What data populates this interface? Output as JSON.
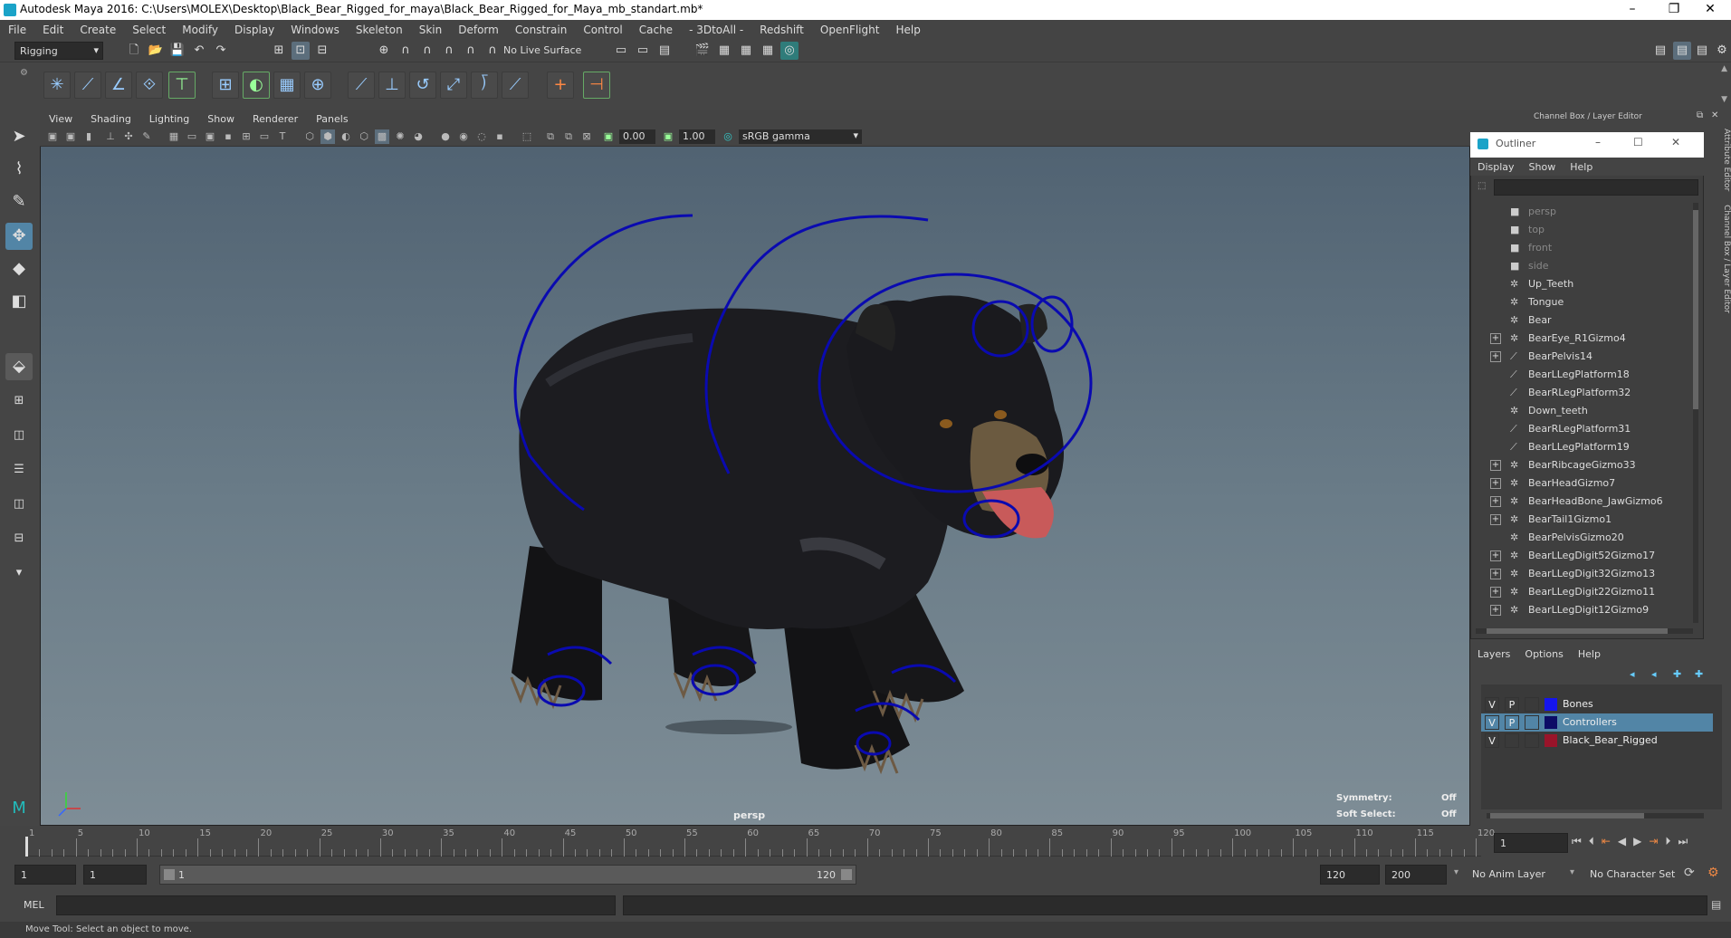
{
  "window": {
    "title": "Autodesk Maya 2016: C:\\Users\\MOLEX\\Desktop\\Black_Bear_Rigged_for_maya\\Black_Bear_Rigged_for_Maya_mb_standart.mb*",
    "minimize": "–",
    "maximize": "❐",
    "close": "✕"
  },
  "menubar": [
    "File",
    "Edit",
    "Create",
    "Select",
    "Modify",
    "Display",
    "Windows",
    "Skeleton",
    "Skin",
    "Deform",
    "Constrain",
    "Control",
    "Cache",
    "- 3DtoAll -",
    "Redshift",
    "OpenFlight",
    "Help"
  ],
  "status": {
    "menuset": "Rigging",
    "live_surface": "No Live Surface"
  },
  "viewport": {
    "menu": [
      "View",
      "Shading",
      "Lighting",
      "Show",
      "Renderer",
      "Panels"
    ],
    "field1": "0.00",
    "field2": "1.00",
    "colorspace": "sRGB gamma",
    "camera": "persp",
    "hud": {
      "symmetry_label": "Symmetry:",
      "symmetry_value": "Off",
      "softselect_label": "Soft Select:",
      "softselect_value": "Off"
    }
  },
  "right_panel": {
    "header": "Channel Box / Layer Editor",
    "side_tabs": [
      "Attribute Editor",
      "Channel Box / Layer Editor"
    ]
  },
  "outliner": {
    "title": "Outliner",
    "menu": [
      "Display",
      "Show",
      "Help"
    ],
    "items": [
      {
        "label": "persp",
        "dim": true,
        "expand": false,
        "icon": "camera-icon"
      },
      {
        "label": "top",
        "dim": true,
        "expand": false,
        "icon": "camera-icon"
      },
      {
        "label": "front",
        "dim": true,
        "expand": false,
        "icon": "camera-icon"
      },
      {
        "label": "side",
        "dim": true,
        "expand": false,
        "icon": "camera-icon"
      },
      {
        "label": "Up_Teeth",
        "dim": false,
        "expand": false,
        "icon": "mesh-icon"
      },
      {
        "label": "Tongue",
        "dim": false,
        "expand": false,
        "icon": "mesh-icon"
      },
      {
        "label": "Bear",
        "dim": false,
        "expand": false,
        "icon": "mesh-icon"
      },
      {
        "label": "BearEye_R1Gizmo4",
        "dim": false,
        "expand": true,
        "icon": "mesh-icon"
      },
      {
        "label": "BearPelvis14",
        "dim": false,
        "expand": true,
        "icon": "joint-icon"
      },
      {
        "label": "BearLLegPlatform18",
        "dim": false,
        "expand": false,
        "icon": "joint-icon"
      },
      {
        "label": "BearRLegPlatform32",
        "dim": false,
        "expand": false,
        "icon": "joint-icon"
      },
      {
        "label": "Down_teeth",
        "dim": false,
        "expand": false,
        "icon": "mesh-icon"
      },
      {
        "label": "BearRLegPlatform31",
        "dim": false,
        "expand": false,
        "icon": "joint-icon"
      },
      {
        "label": "BearLLegPlatform19",
        "dim": false,
        "expand": false,
        "icon": "joint-icon"
      },
      {
        "label": "BearRibcageGizmo33",
        "dim": false,
        "expand": true,
        "icon": "mesh-icon"
      },
      {
        "label": "BearHeadGizmo7",
        "dim": false,
        "expand": true,
        "icon": "mesh-icon"
      },
      {
        "label": "BearHeadBone_JawGizmo6",
        "dim": false,
        "expand": true,
        "icon": "mesh-icon"
      },
      {
        "label": "BearTail1Gizmo1",
        "dim": false,
        "expand": true,
        "icon": "mesh-icon"
      },
      {
        "label": "BearPelvisGizmo20",
        "dim": false,
        "expand": false,
        "icon": "mesh-icon"
      },
      {
        "label": "BearLLegDigit52Gizmo17",
        "dim": false,
        "expand": true,
        "icon": "mesh-icon"
      },
      {
        "label": "BearLLegDigit32Gizmo13",
        "dim": false,
        "expand": true,
        "icon": "mesh-icon"
      },
      {
        "label": "BearLLegDigit22Gizmo11",
        "dim": false,
        "expand": true,
        "icon": "mesh-icon"
      },
      {
        "label": "BearLLegDigit12Gizmo9",
        "dim": false,
        "expand": true,
        "icon": "mesh-icon"
      }
    ]
  },
  "layers": {
    "menu": [
      "Layers",
      "Options",
      "Help"
    ],
    "rows": [
      {
        "v": "V",
        "p": "P",
        "name": "Bones",
        "color": "#1515ee",
        "selected": false
      },
      {
        "v": "V",
        "p": "P",
        "name": "Controllers",
        "color": "#0c0c66",
        "selected": true
      },
      {
        "v": "V",
        "p": "",
        "name": "Black_Bear_Rigged",
        "color": "#99142a",
        "selected": false
      }
    ]
  },
  "timeline": {
    "labels": [
      "1",
      "5",
      "10",
      "15",
      "20",
      "25",
      "30",
      "35",
      "40",
      "45",
      "50",
      "55",
      "60",
      "65",
      "70",
      "75",
      "80",
      "85",
      "90",
      "95",
      "100",
      "105",
      "110",
      "115",
      "120"
    ],
    "current_frame": "1"
  },
  "range": {
    "start": "1",
    "playback_start": "1",
    "slider_start": "1",
    "slider_end": "120",
    "playback_end": "120",
    "end": "200",
    "anim_layer": "No Anim Layer",
    "character_set": "No Character Set"
  },
  "command": {
    "mode": "MEL"
  },
  "helpline": "Move Tool: Select an object to move.",
  "colors": {
    "rig_blue": "#0a0ab0",
    "selected_row": "#5285a6"
  }
}
